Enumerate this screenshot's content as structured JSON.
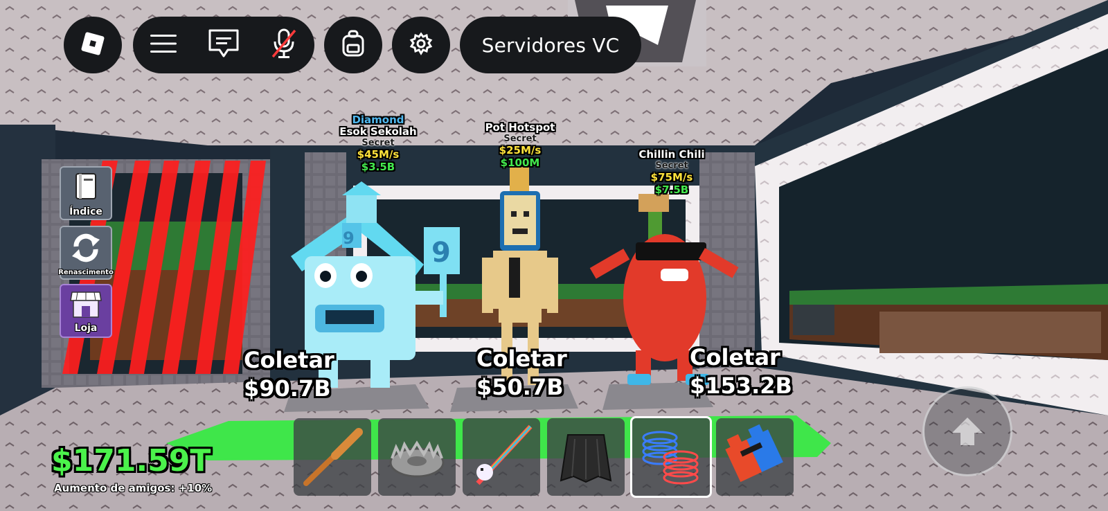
{
  "topbar": {
    "roblox_menu_icon": "roblox-logo-icon",
    "menu_icon": "hamburger-icon",
    "chat_icon": "chat-icon",
    "mic_icon": "mic-muted-icon",
    "backpack_icon": "backpack-icon",
    "settings_icon": "gear-icon",
    "vc_label": "Servidores VC"
  },
  "side_menu": {
    "index_label": "Índice",
    "rebirth_label": "Renascimento",
    "shop_label": "Loja"
  },
  "brainrots": [
    {
      "mutation": "Diamond",
      "name": "Esok Sekolah",
      "rarity": "Secret",
      "rate": "$45M/s",
      "price": "$3.5B",
      "collect_label": "Coletar",
      "collect_amount": "$90.7B"
    },
    {
      "mutation": "",
      "name": "Pot Hotspot",
      "rarity": "Secret",
      "rate": "$25M/s",
      "price": "$100M",
      "collect_label": "Coletar",
      "collect_amount": "$50.7B"
    },
    {
      "mutation": "",
      "name": "Chillin Chili",
      "rarity": "Secret",
      "rate": "$75M/s",
      "price": "$7.5B",
      "collect_label": "Coletar",
      "collect_amount": "$153.2B"
    }
  ],
  "hotbar": {
    "slots": [
      "bat-icon",
      "bear-trap-icon",
      "unicorn-sword-icon",
      "cloak-icon",
      "speed-coil-icon",
      "body-swap-icon"
    ],
    "selected_index": 4
  },
  "player": {
    "money": "$171.59T",
    "friend_boost": "Aumento de amigos: +10%"
  },
  "colors": {
    "money_green": "#4bf24b",
    "rate_yellow": "#ffe23a",
    "price_green": "#43e84d",
    "diamond_blue": "#4fb8ef",
    "laser_red": "#ff1e1e"
  }
}
